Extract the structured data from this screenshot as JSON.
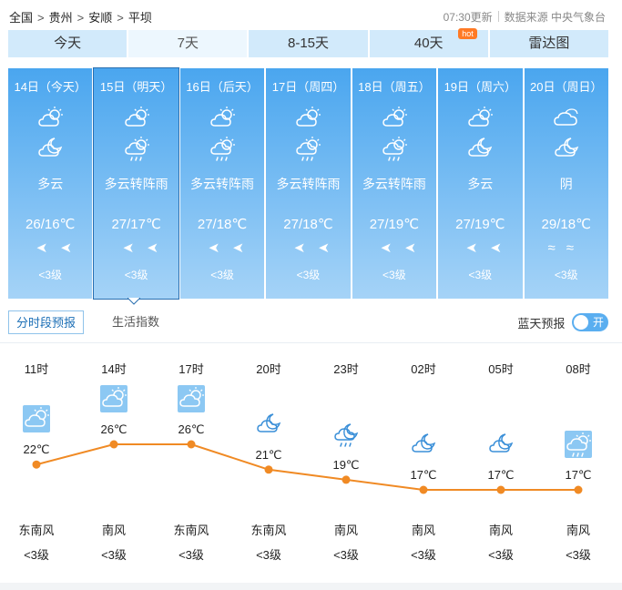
{
  "breadcrumb": [
    "全国",
    "贵州",
    "安顺",
    "平坝"
  ],
  "breadcrumb_sep": ">",
  "meta": {
    "updated": "07:30更新",
    "source": "数据来源 中央气象台"
  },
  "tabs": [
    {
      "label": "今天",
      "active": false
    },
    {
      "label": "7天",
      "active": true
    },
    {
      "label": "8-15天",
      "active": false
    },
    {
      "label": "40天",
      "active": false,
      "badge": "hot"
    },
    {
      "label": "雷达图",
      "active": false
    }
  ],
  "days": [
    {
      "date": "14日（今天）",
      "desc": "多云",
      "temp": "26/16℃",
      "wind_level": "<3级",
      "icon_day": "partly-cloudy-day-icon",
      "icon_night": "partly-cloudy-night-icon",
      "selected": false
    },
    {
      "date": "15日（明天）",
      "desc": "多云转阵雨",
      "temp": "27/17℃",
      "wind_level": "<3级",
      "icon_day": "partly-cloudy-day-icon",
      "icon_night": "shower-icon",
      "selected": true
    },
    {
      "date": "16日（后天）",
      "desc": "多云转阵雨",
      "temp": "27/18℃",
      "wind_level": "<3级",
      "icon_day": "partly-cloudy-day-icon",
      "icon_night": "shower-icon",
      "selected": false
    },
    {
      "date": "17日（周四）",
      "desc": "多云转阵雨",
      "temp": "27/18℃",
      "wind_level": "<3级",
      "icon_day": "partly-cloudy-day-icon",
      "icon_night": "shower-icon",
      "selected": false
    },
    {
      "date": "18日（周五）",
      "desc": "多云转阵雨",
      "temp": "27/19℃",
      "wind_level": "<3级",
      "icon_day": "partly-cloudy-day-icon",
      "icon_night": "shower-icon",
      "selected": false
    },
    {
      "date": "19日（周六）",
      "desc": "多云",
      "temp": "27/19℃",
      "wind_level": "<3级",
      "icon_day": "partly-cloudy-day-icon",
      "icon_night": "partly-cloudy-night-icon",
      "selected": false
    },
    {
      "date": "20日（周日）",
      "desc": "阴",
      "temp": "29/18℃",
      "wind_level": "<3级",
      "icon_day": "overcast-icon",
      "icon_night": "cloudy-night-icon",
      "selected": false,
      "wind_icon": "variable-wind-icon"
    }
  ],
  "wind_glyphs": {
    "arrows": "➤➤",
    "variable": "≈≈"
  },
  "subtabs": {
    "active": "分时段预报",
    "other": "生活指数"
  },
  "blue_sky": {
    "label": "蓝天预报",
    "toggle_text": "开",
    "on": true
  },
  "colors": {
    "accent": "#4aa6ef",
    "line": "#f08a24",
    "badge": "#ff7a25"
  },
  "chart_data": {
    "type": "line",
    "x": [
      "11时",
      "14时",
      "17时",
      "20时",
      "23时",
      "02时",
      "05时",
      "08时"
    ],
    "series": [
      {
        "values": [
          22,
          26,
          26,
          21,
          19,
          17,
          17,
          17
        ]
      }
    ],
    "value_labels": [
      "22℃",
      "26℃",
      "26℃",
      "21℃",
      "19℃",
      "17℃",
      "17℃",
      "17℃"
    ],
    "icons": [
      "partly-cloudy-day-icon",
      "partly-cloudy-day-icon",
      "partly-cloudy-day-icon",
      "cloudy-night-icon",
      "shower-night-icon",
      "cloudy-night-icon",
      "cloudy-night-icon",
      "shower-icon"
    ],
    "wind_dir": [
      "东南风",
      "南风",
      "东南风",
      "东南风",
      "南风",
      "南风",
      "南风",
      "南风"
    ],
    "wind_level": [
      "<3级",
      "<3级",
      "<3级",
      "<3级",
      "<3级",
      "<3级",
      "<3级",
      "<3级"
    ],
    "grid": false,
    "legend": "none"
  }
}
